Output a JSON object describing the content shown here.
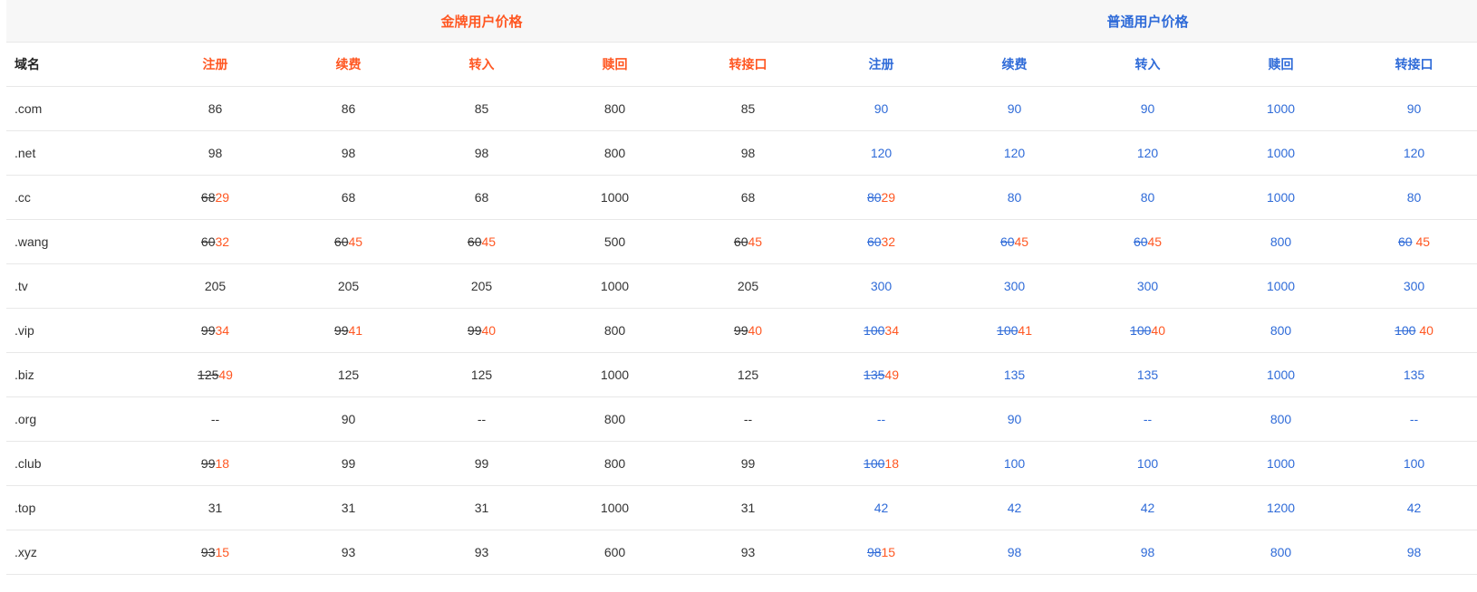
{
  "colors": {
    "gold_accent": "#ff5722",
    "normal_accent": "#2f6bd8",
    "text": "#333333",
    "header_bg": "#f7f7f7",
    "border": "#e8e8e8"
  },
  "groups": {
    "gold": "金牌用户价格",
    "normal": "普通用户价格"
  },
  "columns": {
    "name": "域名",
    "gold": [
      "注册",
      "续费",
      "转入",
      "赎回",
      "转接口"
    ],
    "normal": [
      "注册",
      "续费",
      "转入",
      "赎回",
      "转接口"
    ]
  },
  "rows": [
    {
      "name": ".com",
      "gold": [
        {
          "v": "86"
        },
        {
          "v": "86"
        },
        {
          "v": "85"
        },
        {
          "v": "800"
        },
        {
          "v": "85"
        }
      ],
      "normal": [
        {
          "v": "90"
        },
        {
          "v": "90"
        },
        {
          "v": "90"
        },
        {
          "v": "1000"
        },
        {
          "v": "90"
        }
      ]
    },
    {
      "name": ".net",
      "gold": [
        {
          "v": "98"
        },
        {
          "v": "98"
        },
        {
          "v": "98"
        },
        {
          "v": "800"
        },
        {
          "v": "98"
        }
      ],
      "normal": [
        {
          "v": "120"
        },
        {
          "v": "120"
        },
        {
          "v": "120"
        },
        {
          "v": "1000"
        },
        {
          "v": "120"
        }
      ]
    },
    {
      "name": ".cc",
      "gold": [
        {
          "old": "68",
          "new": "29"
        },
        {
          "v": "68"
        },
        {
          "v": "68"
        },
        {
          "v": "1000"
        },
        {
          "v": "68"
        }
      ],
      "normal": [
        {
          "old": "80",
          "new": "29"
        },
        {
          "v": "80"
        },
        {
          "v": "80"
        },
        {
          "v": "1000"
        },
        {
          "v": "80"
        }
      ]
    },
    {
      "name": ".wang",
      "gold": [
        {
          "old": "60",
          "new": "32"
        },
        {
          "old": "60",
          "new": "45"
        },
        {
          "old": "60",
          "new": "45"
        },
        {
          "v": "500"
        },
        {
          "old": "60",
          "new": "45"
        }
      ],
      "normal": [
        {
          "old": "60",
          "new": "32"
        },
        {
          "old": "60",
          "new": "45"
        },
        {
          "old": "60",
          "new": "45"
        },
        {
          "v": "800"
        },
        {
          "old": "60",
          "new": "45",
          "sep": " "
        }
      ]
    },
    {
      "name": ".tv",
      "gold": [
        {
          "v": "205"
        },
        {
          "v": "205"
        },
        {
          "v": "205"
        },
        {
          "v": "1000"
        },
        {
          "v": "205"
        }
      ],
      "normal": [
        {
          "v": "300"
        },
        {
          "v": "300"
        },
        {
          "v": "300"
        },
        {
          "v": "1000"
        },
        {
          "v": "300"
        }
      ]
    },
    {
      "name": ".vip",
      "gold": [
        {
          "old": "99",
          "new": "34"
        },
        {
          "old": "99",
          "new": "41"
        },
        {
          "old": "99",
          "new": "40"
        },
        {
          "v": "800"
        },
        {
          "old": "99",
          "new": "40"
        }
      ],
      "normal": [
        {
          "old": "100",
          "new": "34"
        },
        {
          "old": "100",
          "new": "41"
        },
        {
          "old": "100",
          "new": "40"
        },
        {
          "v": "800"
        },
        {
          "old": "100",
          "new": "40",
          "sep": " "
        }
      ]
    },
    {
      "name": ".biz",
      "gold": [
        {
          "old": "125",
          "new": "49"
        },
        {
          "v": "125"
        },
        {
          "v": "125"
        },
        {
          "v": "1000"
        },
        {
          "v": "125"
        }
      ],
      "normal": [
        {
          "old": "135",
          "new": "49"
        },
        {
          "v": "135"
        },
        {
          "v": "135"
        },
        {
          "v": "1000"
        },
        {
          "v": "135"
        }
      ]
    },
    {
      "name": ".org",
      "gold": [
        {
          "v": "--"
        },
        {
          "v": "90"
        },
        {
          "v": "--"
        },
        {
          "v": "800"
        },
        {
          "v": "--"
        }
      ],
      "normal": [
        {
          "v": "--"
        },
        {
          "v": "90"
        },
        {
          "v": "--"
        },
        {
          "v": "800"
        },
        {
          "v": "--"
        }
      ]
    },
    {
      "name": ".club",
      "gold": [
        {
          "old": "99",
          "new": "18"
        },
        {
          "v": "99"
        },
        {
          "v": "99"
        },
        {
          "v": "800"
        },
        {
          "v": "99"
        }
      ],
      "normal": [
        {
          "old": "100",
          "new": "18"
        },
        {
          "v": "100"
        },
        {
          "v": "100"
        },
        {
          "v": "1000"
        },
        {
          "v": "100"
        }
      ]
    },
    {
      "name": ".top",
      "gold": [
        {
          "v": "31"
        },
        {
          "v": "31"
        },
        {
          "v": "31"
        },
        {
          "v": "1000"
        },
        {
          "v": "31"
        }
      ],
      "normal": [
        {
          "v": "42"
        },
        {
          "v": "42"
        },
        {
          "v": "42"
        },
        {
          "v": "1200"
        },
        {
          "v": "42"
        }
      ]
    },
    {
      "name": ".xyz",
      "gold": [
        {
          "old": "93",
          "new": "15"
        },
        {
          "v": "93"
        },
        {
          "v": "93"
        },
        {
          "v": "600"
        },
        {
          "v": "93"
        }
      ],
      "normal": [
        {
          "old": "98",
          "new": "15"
        },
        {
          "v": "98"
        },
        {
          "v": "98"
        },
        {
          "v": "800"
        },
        {
          "v": "98"
        }
      ]
    }
  ]
}
